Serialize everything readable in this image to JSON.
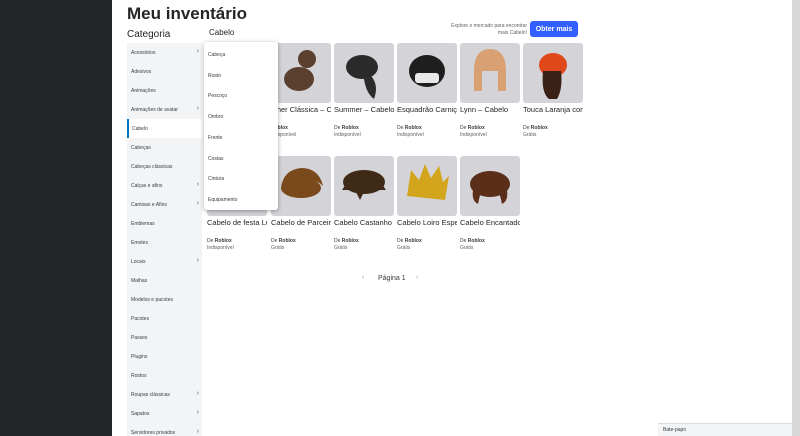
{
  "page": {
    "title": "Meu inventário",
    "category_heading": "Categoria",
    "sub_header": "Cabelo"
  },
  "header": {
    "explore_text": "Explore o mercado para encontrar mais Cabelo!",
    "obter_label": "Obter mais"
  },
  "sidebar": {
    "items": [
      {
        "label": "Acessórios",
        "chevron": true
      },
      {
        "label": "Adesivos",
        "chevron": false
      },
      {
        "label": "Animações",
        "chevron": false
      },
      {
        "label": "Animações de avatar",
        "chevron": true
      },
      {
        "label": "Cabelo",
        "chevron": false,
        "active": true
      },
      {
        "label": "Cabeças",
        "chevron": false
      },
      {
        "label": "Cabeças clássicas",
        "chevron": false
      },
      {
        "label": "Calças e afins",
        "chevron": true
      },
      {
        "label": "Camisas e Afins",
        "chevron": true
      },
      {
        "label": "Emblemas",
        "chevron": false
      },
      {
        "label": "Emotes",
        "chevron": false
      },
      {
        "label": "Locais",
        "chevron": true
      },
      {
        "label": "Malhas",
        "chevron": false
      },
      {
        "label": "Modelos e pacotes",
        "chevron": false
      },
      {
        "label": "Pacotes",
        "chevron": false
      },
      {
        "label": "Passes",
        "chevron": false
      },
      {
        "label": "Plugins",
        "chevron": false
      },
      {
        "label": "Rostos",
        "chevron": false
      },
      {
        "label": "Roupas clássicas",
        "chevron": true
      },
      {
        "label": "Sapatos",
        "chevron": true
      },
      {
        "label": "Servidores privados",
        "chevron": true
      }
    ],
    "chevron_glyph": "›"
  },
  "dropdown": {
    "items": [
      "Cabeça",
      "Rosto",
      "Pescoço",
      "Ombro",
      "Frente",
      "Costas",
      "Cintura",
      "Equipamento"
    ]
  },
  "items": [
    {
      "name": "",
      "creator_prefix": "",
      "creator": "",
      "price": "",
      "icon": "hair-bun-dark-icon",
      "color": "#4a3528"
    },
    {
      "name": "ulher Clássica – Cabelo",
      "creator_prefix": "",
      "creator": "Roblox",
      "price": "ndisponível",
      "icon": "hair-bun-brown-icon",
      "color": "#5b4030"
    },
    {
      "name": "Summer – Cabelo",
      "creator_prefix": "De",
      "creator": "Roblox",
      "price": "Indisponível",
      "icon": "hair-ponytail-icon",
      "color": "#2b2b2b"
    },
    {
      "name": "Esquadrão Carniçal: Tedd, ...",
      "creator_prefix": "De",
      "creator": "Roblox",
      "price": "Indisponível",
      "icon": "hair-helmet-icon",
      "color": "#1e1e1e"
    },
    {
      "name": "Lynn – Cabelo",
      "creator_prefix": "De",
      "creator": "Roblox",
      "price": "Indisponível",
      "icon": "hair-bob-icon",
      "color": "#d9a173"
    },
    {
      "name": "Touca Laranja com Cabelo...",
      "creator_prefix": "De",
      "creator": "Roblox",
      "price": "Grátis",
      "icon": "hair-beanie-icon",
      "color": "#e0491c"
    },
    {
      "name": "Cabelo de festa Luobu",
      "creator_prefix": "De",
      "creator": "Roblox",
      "price": "Indisponível",
      "icon": "hair-party-icon",
      "color": "#6b3a1a"
    },
    {
      "name": "Cabelo de Parceiro",
      "creator_prefix": "De",
      "creator": "Roblox",
      "price": "Grátis",
      "icon": "hair-swept-icon",
      "color": "#7a4a1c"
    },
    {
      "name": "Cabelo Castanho",
      "creator_prefix": "De",
      "creator": "Roblox",
      "price": "Grátis",
      "icon": "hair-messy-icon",
      "color": "#3f2a17"
    },
    {
      "name": "Cabelo Loiro Espetado",
      "creator_prefix": "De",
      "creator": "Roblox",
      "price": "Grátis",
      "icon": "hair-spiky-icon",
      "color": "#d2a51c"
    },
    {
      "name": "Cabelo Encantador...",
      "creator_prefix": "De",
      "creator": "Roblox",
      "price": "Grátis",
      "icon": "hair-charming-icon",
      "color": "#5a2e18"
    }
  ],
  "pagination": {
    "label": "Página 1",
    "prev_glyph": "‹",
    "next_glyph": "›"
  },
  "chat": {
    "label": "Bate-papo"
  }
}
